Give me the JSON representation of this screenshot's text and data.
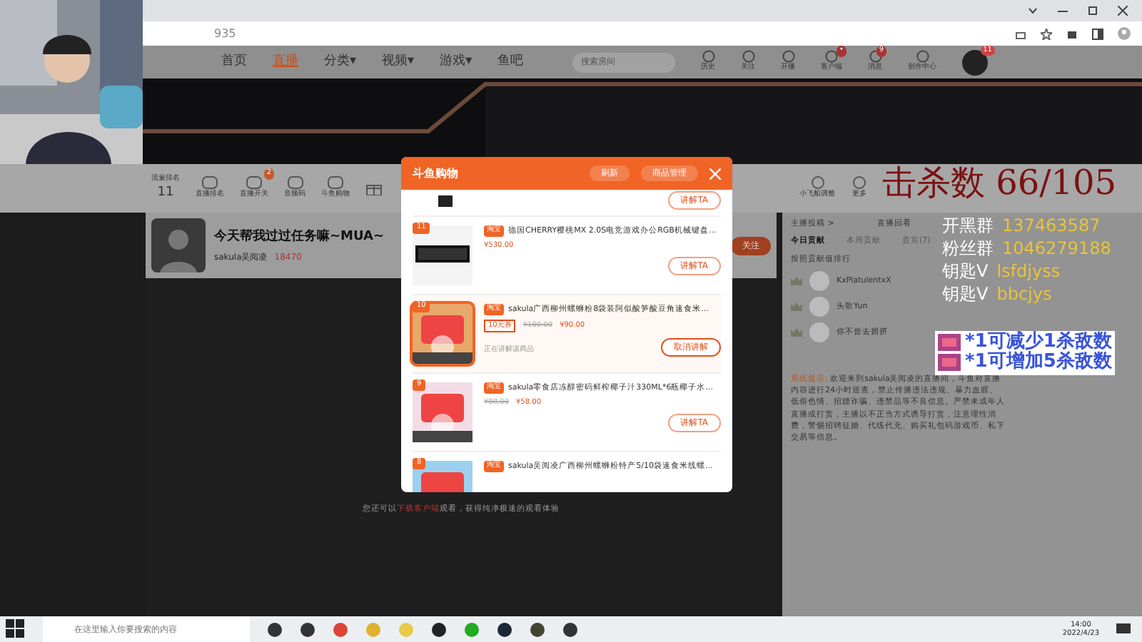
{
  "browser": {
    "url": "935"
  },
  "site_nav": {
    "items": [
      {
        "label": "首页",
        "selected": false
      },
      {
        "label": "直播",
        "selected": true
      },
      {
        "label": "分类▾",
        "selected": false
      },
      {
        "label": "视频▾",
        "selected": false
      },
      {
        "label": "游戏▾",
        "selected": false
      },
      {
        "label": "鱼吧",
        "selected": false
      }
    ],
    "search": {
      "placeholder": "搜索房间"
    },
    "shortcuts": [
      {
        "label": "历史"
      },
      {
        "label": "关注"
      },
      {
        "label": "开播"
      },
      {
        "label": "客户端",
        "badge": "•"
      },
      {
        "label": "消息",
        "badge": "9"
      },
      {
        "label": "创作中心"
      }
    ],
    "avatar_badge": "11"
  },
  "toolbar": {
    "rank_tag": "流量排名",
    "rank": "11",
    "items": [
      {
        "label": "直播排名"
      },
      {
        "label": "直播开关",
        "badge": "2"
      },
      {
        "label": "音频码"
      },
      {
        "label": "斗鱼购物"
      }
    ],
    "right_items": [
      {
        "label": "小飞船调整"
      },
      {
        "label": "更多"
      }
    ]
  },
  "streamer": {
    "title": "今天帮我过过任务嘛~MUA~",
    "name": "sakula吴阅凌",
    "hot": "18470",
    "follow": "关注"
  },
  "player": {
    "before": "您还可以",
    "link": "下载客户端",
    "after": "观看，获得纯净极速的观看体验"
  },
  "modal": {
    "title": "斗鱼购物",
    "buttons": [
      "刷新",
      "商品管理"
    ],
    "products": [
      {
        "kind": "partial_top",
        "button": "讲解TA"
      },
      {
        "kind": "item",
        "rank": "11",
        "platform": "淘宝",
        "title": "德国CHERRY樱桃MX 2.0S电竞游戏办公RGB机械键盘...",
        "price": "¥530.00",
        "button": "讲解TA",
        "selected": false
      },
      {
        "kind": "item",
        "rank": "10",
        "platform": "淘宝",
        "title": "sakula广西柳州螺蛳粉8袋装阿似酸笋酸豆角速食米...",
        "coupon": "10元券",
        "old_price": "¥100.00",
        "price": "¥90.00",
        "status": "正在讲解该商品",
        "button": "取消讲解",
        "selected": true
      },
      {
        "kind": "item",
        "rank": "9",
        "platform": "淘宝",
        "title": "sakula零食店冻醇密码鲜榨椰子汁330ML*6瓶椰子水...",
        "old_price": "¥88.00",
        "price": "¥58.00",
        "button": "讲解TA",
        "selected": false
      },
      {
        "kind": "partial_bottom",
        "rank": "8",
        "platform": "淘宝",
        "title": "sakula吴阅凌广西柳州螺蛳粉特产5/10袋速食米线螺..."
      }
    ]
  },
  "sidebar": {
    "links": [
      "主播投稿 >",
      "直播回看"
    ],
    "tabs": [
      {
        "label": "今日贡献",
        "selected": true
      },
      {
        "label": "本周贡献",
        "selected": false
      },
      {
        "label": "贵宾(7)",
        "selected": false
      }
    ],
    "rank_title": "按照贡献值排行",
    "viewers": [
      {
        "name": "KxPlatulentxX"
      },
      {
        "name": "头歌Yun"
      },
      {
        "name": "你不曾去拥挤"
      }
    ],
    "system": {
      "label": "系统提示:",
      "text": "欢迎来到sakula吴阅凌的直播间，斗鱼对直播内容进行24小时巡查，禁止传播违法违规、暴力血腥、低俗色情、招嫖诈骗、违禁品等不良信息。严禁未成年人直播或打赏，主播以不正当方式诱导打赏，注意理性消费，警惕招聘征婚、代练代充、购买礼包码游戏币、私下交易等信息。"
    }
  },
  "overlay": {
    "kill_count": "击杀数 66/105",
    "info": [
      {
        "label": "开黑群",
        "value": "137463587"
      },
      {
        "label": "粉丝群",
        "value": "1046279188"
      },
      {
        "label": "钥匙V",
        "value": "lsfdjyss"
      },
      {
        "label": "钥匙V",
        "value": "bbcjys"
      }
    ],
    "rules": [
      "*1可减少1杀敌数",
      "*1可增加5杀敌数"
    ]
  },
  "taskbar": {
    "search": {
      "placeholder": "在这里输入你要搜索的内容"
    },
    "time": "14:00",
    "date": "2022/4/23"
  }
}
